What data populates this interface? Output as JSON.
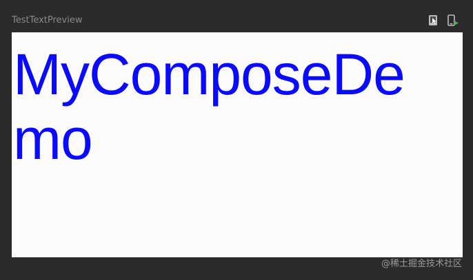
{
  "preview": {
    "title": "TestTextPreview",
    "icons": {
      "interactive_mode": "interactive-mode-icon",
      "deploy_to_device": "deploy-to-device-icon"
    },
    "text": "MyComposeDemo"
  },
  "colors": {
    "background": "#2b2b2b",
    "canvas": "#fcfcfd",
    "text": "#0a0aff",
    "title": "#8a8a8a",
    "deploy_accent": "#4caf50"
  },
  "watermark": {
    "text": "@稀土掘金技术社区"
  }
}
